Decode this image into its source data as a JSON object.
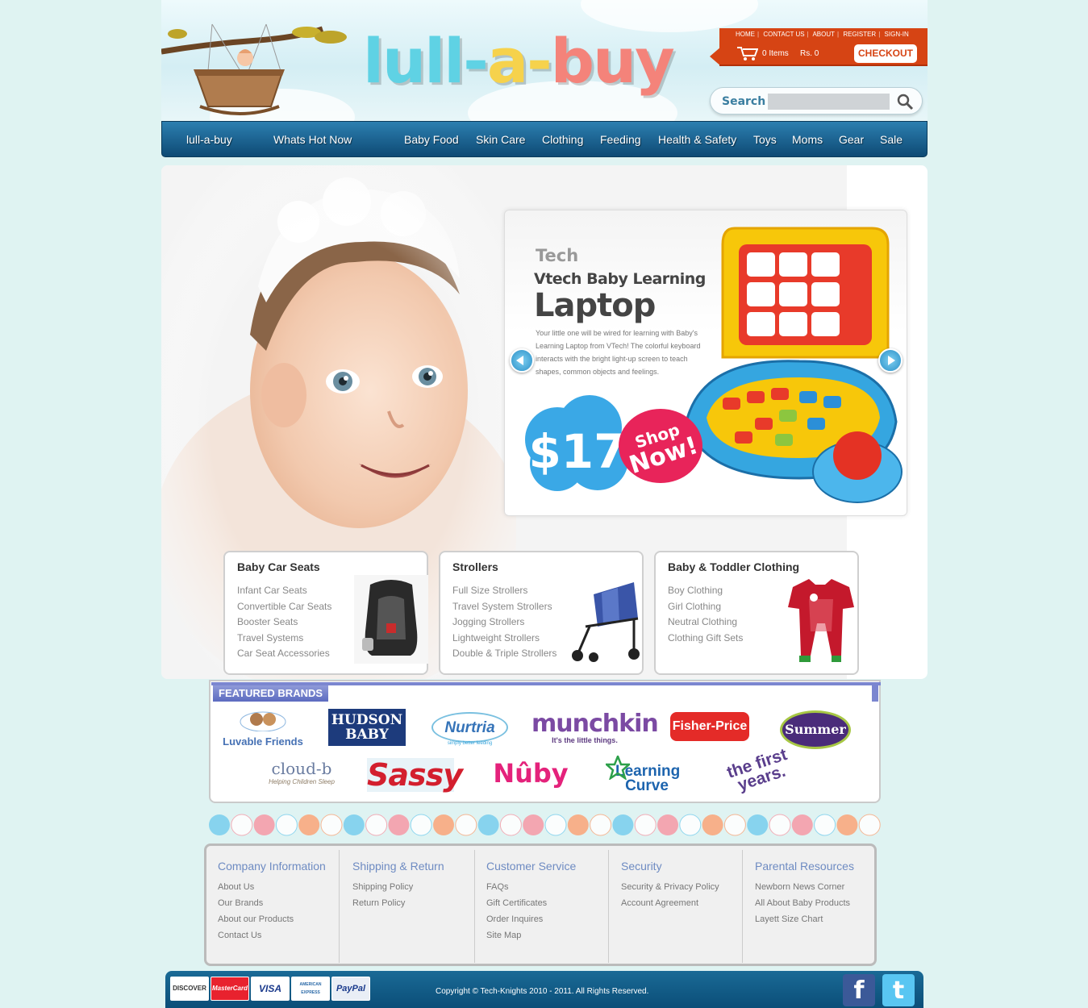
{
  "site": {
    "logo_parts": [
      "lull-",
      "a-",
      "buy"
    ]
  },
  "top_links": [
    "HOME",
    "CONTACT US",
    "ABOUT",
    "REGISTER",
    "SIGN-IN"
  ],
  "cart": {
    "items": "0 Items",
    "total": "Rs. 0",
    "checkout_label": "CHECKOUT"
  },
  "search": {
    "label": "Search",
    "placeholder": ""
  },
  "nav": [
    "lull-a-buy",
    "Whats Hot Now",
    "Baby Food",
    "Skin Care",
    "Clothing",
    "Feeding",
    "Health & Safety",
    "Toys",
    "Moms",
    "Gear",
    "Sale"
  ],
  "slider": {
    "brand": "Tech",
    "line1": "Vtech Baby Learning",
    "line2": "Laptop",
    "description": "Your little one will be wired for learning with Baby's Learning Laptop from VTech! The colorful keyboard interacts with the bright light-up screen to teach shapes, common objects and feelings.",
    "price": "$17",
    "cta_line1": "Shop",
    "cta_line2": "Now!"
  },
  "categories": [
    {
      "title": "Baby Car Seats",
      "items": [
        "Infant Car Seats",
        "Convertible Car Seats",
        "Booster Seats",
        "Travel Systems",
        "Car Seat Accessories"
      ]
    },
    {
      "title": "Strollers",
      "items": [
        "Full Size Strollers",
        "Travel System Strollers",
        "Jogging Strollers",
        "Lightweight Strollers",
        "Double & Triple Strollers"
      ]
    },
    {
      "title": "Baby & Toddler Clothing",
      "items": [
        "Boy Clothing",
        "Girl Clothing",
        "Neutral Clothing",
        "Clothing Gift Sets"
      ]
    }
  ],
  "brands": {
    "title": "FEATURED BRANDS",
    "items": [
      "Luvable Friends",
      "HUDSON BABY",
      "Nurtria",
      "munchkin",
      "Fisher-Price",
      "Summer",
      "cloud-b",
      "Sassy",
      "Nûby",
      "Learning Curve",
      "the first years."
    ],
    "taglines": {
      "nurtria": "simply better feeding",
      "munchkin": "It's the little things.",
      "cloudb": "Helping Children Sleep"
    }
  },
  "footer_columns": [
    {
      "title": "Company Information",
      "links": [
        "About Us",
        "Our Brands",
        "About our Products",
        "Contact Us"
      ]
    },
    {
      "title": "Shipping & Return",
      "links": [
        "Shipping Policy",
        "Return Policy"
      ]
    },
    {
      "title": "Customer Service",
      "links": [
        "FAQs",
        "Gift Certificates",
        "Order Inquires",
        "Site Map"
      ]
    },
    {
      "title": "Security",
      "links": [
        "Security & Privacy Policy",
        "Account Agreement"
      ]
    },
    {
      "title": "Parental Resources",
      "links": [
        "Newborn News Corner",
        "All About Baby Products",
        "Layett Size Chart"
      ]
    }
  ],
  "payment_cards": [
    "DISCOVER",
    "MasterCard",
    "VISA",
    "AMERICAN EXPRESS",
    "PayPal"
  ],
  "copyright": "Copyright © Tech-Knights 2010 - 2011. All Rights Reserved.",
  "social": [
    "f",
    "t"
  ],
  "colors": {
    "nav": "#0e4a74",
    "accent": "#d64414",
    "footer_heading": "#6e8bc2",
    "background": "#dff3f2"
  }
}
